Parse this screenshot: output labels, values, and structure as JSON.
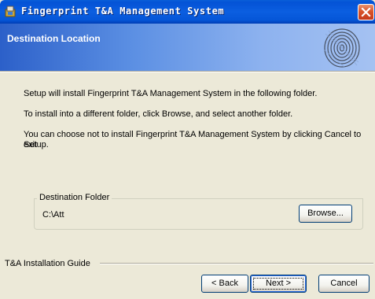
{
  "window": {
    "title": "Fingerprint T&A Management System"
  },
  "header": {
    "title": "Destination Location"
  },
  "body": {
    "line1": "Setup will install  Fingerprint T&A Management System in the following folder.",
    "line2": "To install into a different folder, click Browse, and select another folder.",
    "line3a": "You can choose not to install  Fingerprint T&A Management System by clicking Cancel to exit",
    "line3b": "Setup."
  },
  "destination": {
    "legend": "Destination Folder",
    "path": "C:\\Att",
    "browse_label": "Browse..."
  },
  "footer": {
    "guide_label": "T&A Installation Guide",
    "back_label": "< Back",
    "next_label": "Next >",
    "cancel_label": "Cancel"
  },
  "colors": {
    "titlebar": "#0453d6",
    "header_start": "#2c60c9",
    "header_end": "#a5c2f2",
    "dialog_bg": "#ece9d8",
    "close_button": "#d8532a"
  },
  "icons": {
    "app": "installer-icon",
    "close": "close-icon",
    "banner": "fingerprint-icon"
  }
}
